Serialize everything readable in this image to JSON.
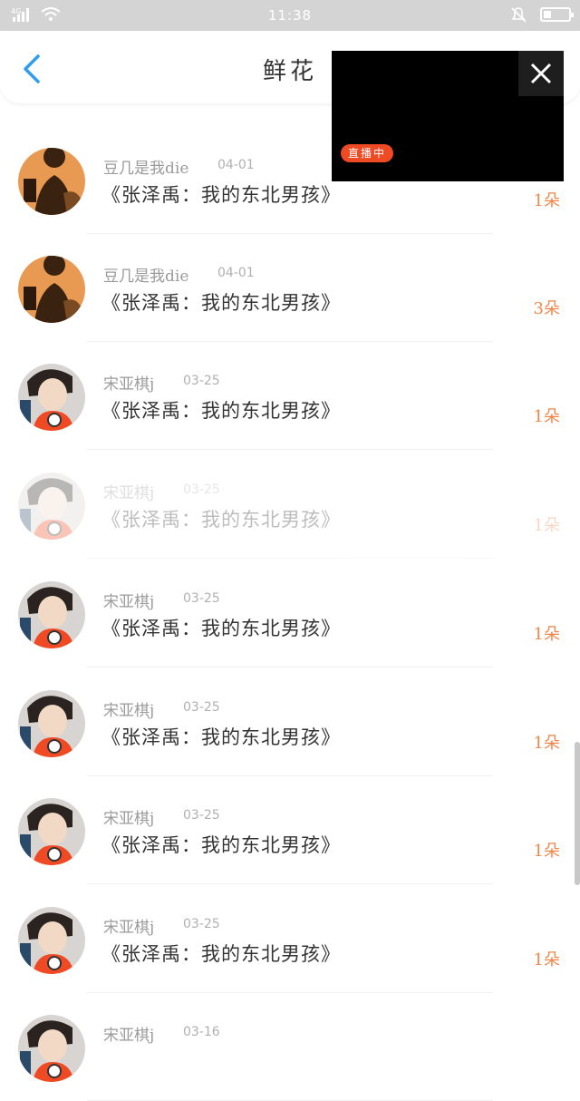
{
  "status_bar": {
    "signal": "4G",
    "time": "11:38"
  },
  "header": {
    "title": "鲜花"
  },
  "video": {
    "live_label": "直播中"
  },
  "colors": {
    "accent": "#2f9cf0",
    "count": "#f0864a",
    "live": "#f04a24"
  },
  "rows": [
    {
      "user": "豆几是我die",
      "date": "04-01",
      "message": "《张泽禹：我的东北男孩》",
      "count": "1朵",
      "avatar": "avatar-silhouette"
    },
    {
      "user": "豆几是我die",
      "date": "04-01",
      "message": "《张泽禹：我的东北男孩》",
      "count": "3朵",
      "avatar": "avatar-silhouette"
    },
    {
      "user": "宋亚棋j",
      "date": "03-25",
      "message": "《张泽禹：我的东北男孩》",
      "count": "1朵",
      "avatar": "avatar-portrait"
    },
    {
      "user": "宋亚棋j",
      "date": "03-25",
      "message": "《张泽禹：我的东北男孩》",
      "count": "1朵",
      "avatar": "avatar-portrait"
    },
    {
      "user": "宋亚棋j",
      "date": "03-25",
      "message": "《张泽禹：我的东北男孩》",
      "count": "1朵",
      "avatar": "avatar-portrait"
    },
    {
      "user": "宋亚棋j",
      "date": "03-25",
      "message": "《张泽禹：我的东北男孩》",
      "count": "1朵",
      "avatar": "avatar-portrait"
    },
    {
      "user": "宋亚棋j",
      "date": "03-25",
      "message": "《张泽禹：我的东北男孩》",
      "count": "1朵",
      "avatar": "avatar-portrait"
    },
    {
      "user": "宋亚棋j",
      "date": "03-25",
      "message": "《张泽禹：我的东北男孩》",
      "count": "1朵",
      "avatar": "avatar-portrait"
    },
    {
      "user": "宋亚棋j",
      "date": "03-16",
      "message": "",
      "count": "",
      "avatar": "avatar-portrait"
    }
  ]
}
